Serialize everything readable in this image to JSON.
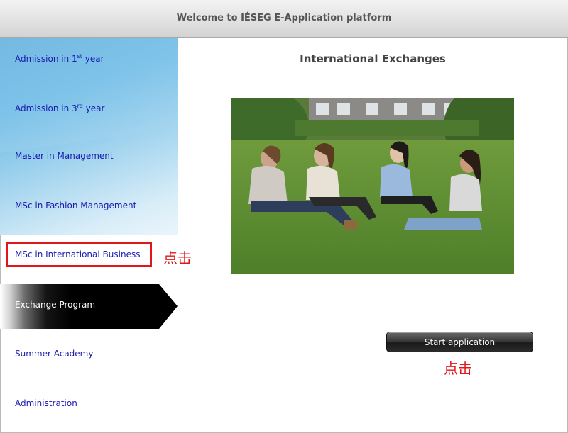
{
  "header": {
    "title": "Welcome to IÉSEG E-Application platform"
  },
  "sidebar": {
    "items": [
      {
        "label_prefix": "Admission in 1",
        "sup": "st",
        "label_suffix": " year"
      },
      {
        "label_prefix": "Admission in 3",
        "sup": "rd",
        "label_suffix": " year"
      },
      {
        "label": "Master in Management"
      },
      {
        "label": "MSc in Fashion Management"
      },
      {
        "label": "MSc in International Business"
      },
      {
        "label": "Exchange Program"
      },
      {
        "label": "Summer Academy"
      },
      {
        "label": "Administration"
      }
    ]
  },
  "annotations": {
    "click_1": "点击",
    "click_2": "点击",
    "color": "#e0161b"
  },
  "main": {
    "title": "International Exchanges",
    "start_button": "Start application"
  },
  "colors": {
    "nav_link": "#1a1ab0",
    "active_nav_bg": "#000000",
    "highlight_box": "#e0161b"
  }
}
